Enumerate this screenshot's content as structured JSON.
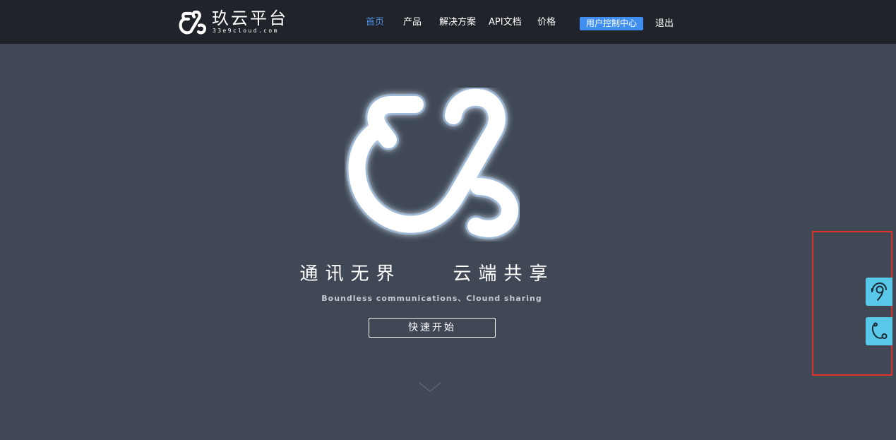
{
  "header": {
    "brand": {
      "name": "玖云平台",
      "domain": "33e9cloud.com"
    },
    "nav": [
      {
        "label": "首页",
        "active": true
      },
      {
        "label": "产品",
        "active": false
      },
      {
        "label": "解决方案",
        "active": false
      },
      {
        "label": "API文档",
        "active": false
      },
      {
        "label": "价格",
        "active": false
      }
    ],
    "console_label": "用户控制中心",
    "logout_label": "退出"
  },
  "hero": {
    "slogan_cn": "通讯无界    云端共享",
    "slogan_en": "Boundless communications、Clound sharing",
    "start_button": "快速开始"
  },
  "side_widgets": [
    {
      "icon": "headset-icon"
    },
    {
      "icon": "phone-icon"
    }
  ],
  "colors": {
    "header_bg": "#202329",
    "page_bg": "#404856",
    "active_nav": "#4a90e2",
    "console_button": "#3f8ef0",
    "side_widget": "#57c8e8",
    "highlight_border": "#e0312b"
  }
}
